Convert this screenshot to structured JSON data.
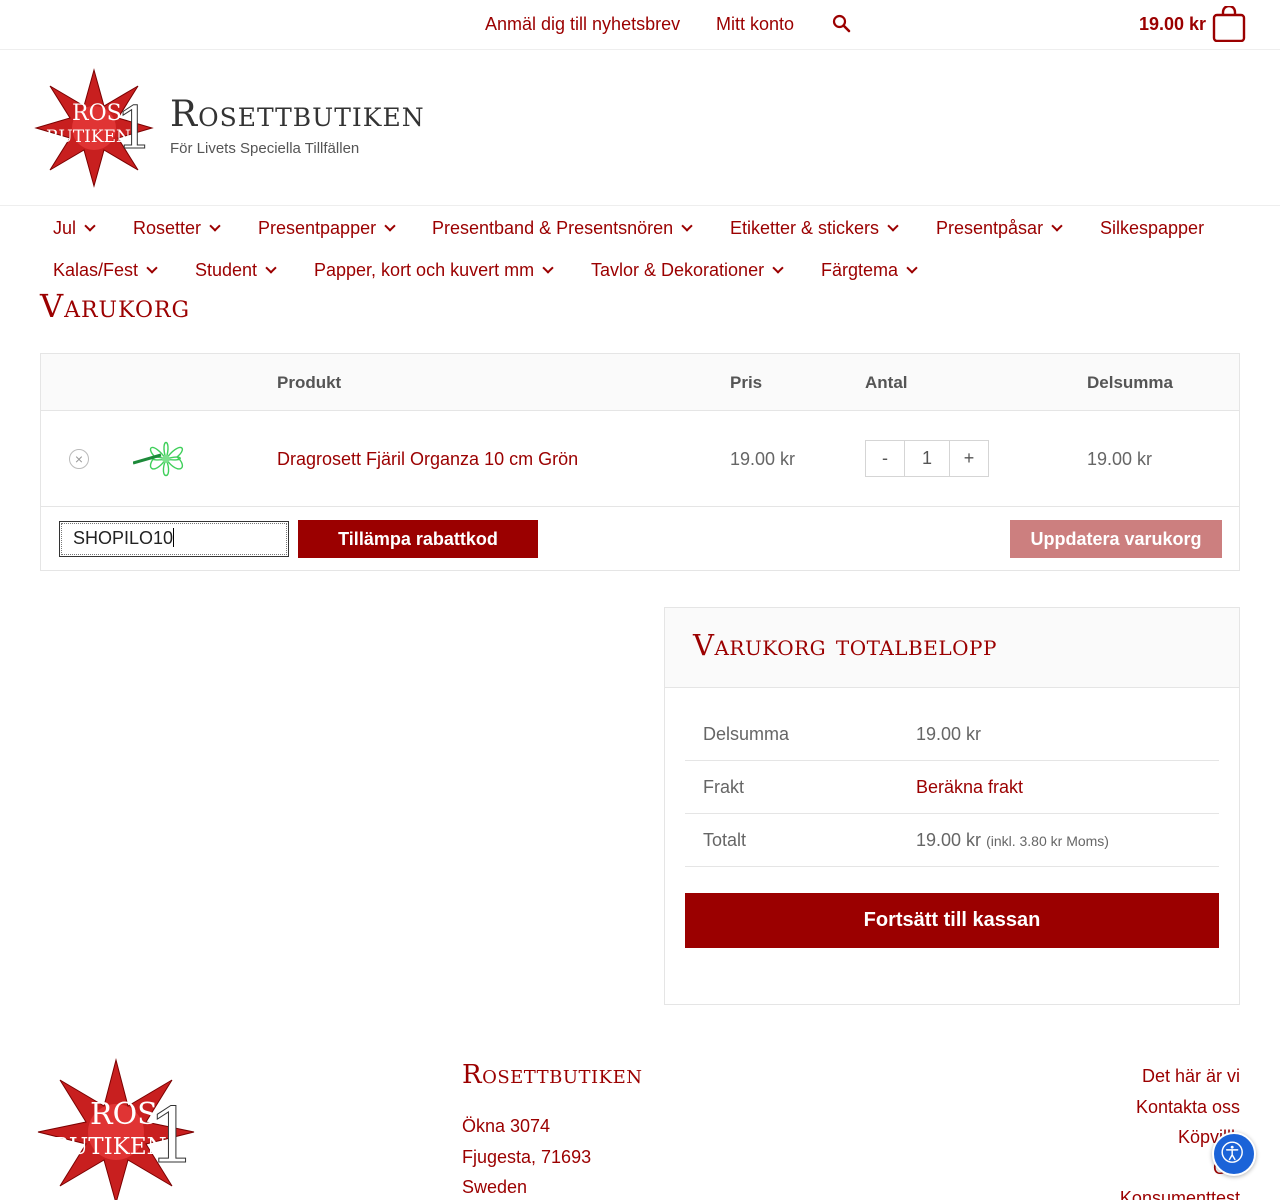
{
  "topbar": {
    "newsletter": "Anmäl dig till nyhetsbrev",
    "account": "Mitt konto",
    "cart_total": "19.00 kr"
  },
  "header": {
    "logo_text_top": "ROS",
    "logo_text_bottom": "BUTIKEN",
    "logo_digit": "1",
    "site_title": "Rosettbutiken",
    "tagline": "För Livets Speciella Tillfällen"
  },
  "nav": {
    "row1": [
      "Jul",
      "Rosetter",
      "Presentpapper",
      "Presentband & Presentsnören",
      "Etiketter & stickers",
      "Presentpåsar",
      "Silkespapper"
    ],
    "row2": [
      "Kalas/Fest",
      "Student",
      "Papper, kort och kuvert mm",
      "Tavlor & Dekorationer",
      "Färgtema"
    ]
  },
  "page_title": "Varukorg",
  "cart": {
    "headers": {
      "product": "Produkt",
      "price": "Pris",
      "quantity": "Antal",
      "subtotal": "Delsumma"
    },
    "items": [
      {
        "name": "Dragrosett Fjäril Organza 10 cm Grön",
        "price": "19.00 kr",
        "quantity": "1",
        "subtotal": "19.00 kr",
        "remove": "×"
      }
    ],
    "qty_minus": "-",
    "qty_plus": "+",
    "coupon_value": "SHOPILO10",
    "apply_label": "Tillämpa rabattkod",
    "update_label": "Uppdatera varukorg"
  },
  "totals": {
    "title": "Varukorg totalbelopp",
    "subtotal_label": "Delsumma",
    "subtotal_value": "19.00 kr",
    "shipping_label": "Frakt",
    "shipping_value": "Beräkna frakt",
    "total_label": "Totalt",
    "total_value": "19.00 kr",
    "total_note": "(inkl. 3.80 kr Moms)",
    "checkout_label": "Fortsätt till kassan"
  },
  "footer": {
    "title": "Rosettbutiken",
    "address": [
      "Ökna 3074",
      "Fjugesta, 71693",
      "Sweden"
    ],
    "links": [
      "Det här är vi",
      "Kontakta oss",
      "Köpvillk",
      "GD",
      "Konsumenttest"
    ]
  },
  "colors": {
    "brand": "#9b0000",
    "update_button": "#cc7f7f",
    "accessibility": "#1b63d8"
  },
  "icons": [
    "search-icon",
    "shopping-bag-icon",
    "chevron-down-icon",
    "remove-circle-icon",
    "accessibility-icon"
  ]
}
